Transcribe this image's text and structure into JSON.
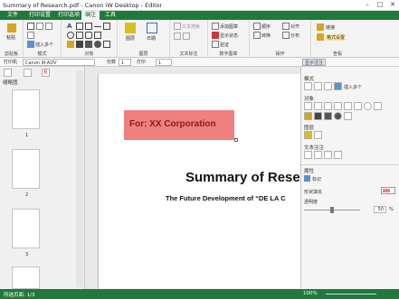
{
  "window": {
    "title": "Summary of Research.pdf - Canon iW Desktop - Editor",
    "minimize": "–",
    "maximize": "□",
    "close": "✕"
  },
  "tabs": [
    "文件",
    "打印设置",
    "打印选项",
    "编注",
    "工具"
  ],
  "ribbon": {
    "groups": {
      "clipboard": "剪贴板",
      "mode": "模式",
      "object": "对象",
      "layer": "图层",
      "text_annot": "文本标注",
      "digital_stamp": "数字图章",
      "operation": "操作",
      "check": "查看"
    },
    "buttons": {
      "paste": "粘贴",
      "insert_image": "插入多个",
      "layer": "图层",
      "date": "日期",
      "text_search": "文本搜索",
      "add_stamp": "添加图章",
      "show_stamp": "显示状态",
      "verify": "验证",
      "order": "顺序",
      "align": "对齐",
      "distribute": "分布",
      "convert": "转换",
      "link": "链接",
      "format_settings": "格式设置"
    }
  },
  "toolbar": {
    "printer_label": "打印机",
    "printer_value": "Canon iR-ADV",
    "copies_label": "份数",
    "copies_value": "1",
    "print_button": "打印",
    "page_value": "1",
    "annotation_button": "显示注注"
  },
  "left_pane": {
    "section_title": "缩略图",
    "page_numbers": [
      "1",
      "2",
      "3"
    ]
  },
  "document": {
    "stamp_text": "For: XX Corporation",
    "heading": "Summary of Rese",
    "subheading": "The Future Development of “DE LA C"
  },
  "right_pane": {
    "mode_title": "模式",
    "insert_label": "插入多个",
    "object_title": "对象",
    "layer_title": "图层",
    "text_annot_title": "文本注注",
    "properties_title": "属性",
    "annot_label": "标记",
    "fill_label": "形状填充",
    "opacity_label": "透明度",
    "opacity_value": "50",
    "opacity_unit": "%"
  },
  "status": {
    "left": "所选页面: 1/3",
    "zoom": "100%"
  },
  "colors": {
    "accent": "#1f7a3a",
    "stamp_fill": "#f08080",
    "stamp_text": "#8b1a1a"
  }
}
